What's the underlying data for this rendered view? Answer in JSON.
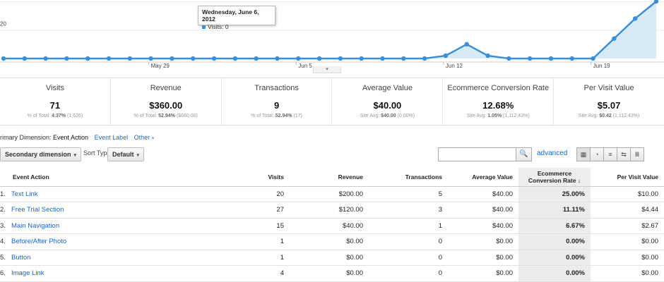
{
  "chart_data": {
    "type": "area",
    "x": [
      "May 22",
      "May 23",
      "May 24",
      "May 25",
      "May 26",
      "May 27",
      "May 28",
      "May 29",
      "May 30",
      "May 31",
      "Jun 1",
      "Jun 2",
      "Jun 3",
      "Jun 4",
      "Jun 5",
      "Jun 6",
      "Jun 7",
      "Jun 8",
      "Jun 9",
      "Jun 10",
      "Jun 11",
      "Jun 12",
      "Jun 13",
      "Jun 14",
      "Jun 15",
      "Jun 16",
      "Jun 17",
      "Jun 18",
      "Jun 19",
      "Jun 20",
      "Jun 21",
      "Jun 22"
    ],
    "series": [
      {
        "values": [
          0,
          0,
          0,
          0,
          0,
          0,
          0,
          0,
          0,
          0,
          0,
          0,
          0,
          0,
          0,
          0,
          0,
          0,
          0,
          0,
          0,
          1,
          5,
          1,
          0,
          0,
          0,
          0,
          0,
          7,
          14,
          20
        ]
      }
    ],
    "y_tick_labels": [
      "20"
    ],
    "x_tick_labels": [
      "May 29",
      "Jun 5",
      "Jun 12",
      "Jun 19"
    ],
    "ylim": [
      0,
      20
    ],
    "color": "#3a8fd6",
    "fill": "#d9eaf7",
    "grid": true
  },
  "tooltip": {
    "date": "Wednesday, June 6, 2012",
    "series": "Visits: 0"
  },
  "summary": [
    {
      "label": "Visits",
      "value": "71",
      "sub_prefix": "% of Total: ",
      "sub_bold": "4.37%",
      "sub_suffix": " (1,626)"
    },
    {
      "label": "Revenue",
      "value": "$360.00",
      "sub_prefix": "% of Total: ",
      "sub_bold": "52.94%",
      "sub_suffix": " ($680.00)"
    },
    {
      "label": "Transactions",
      "value": "9",
      "sub_prefix": "% of Total: ",
      "sub_bold": "52.94%",
      "sub_suffix": " (17)"
    },
    {
      "label": "Average Value",
      "value": "$40.00",
      "sub_prefix": "Site Avg: ",
      "sub_bold": "$40.00",
      "sub_suffix": " (0.00%)"
    },
    {
      "label": "Ecommerce Conversion Rate",
      "value": "12.68%",
      "sub_prefix": "Site Avg: ",
      "sub_bold": "1.05%",
      "sub_suffix": " (1,112.43%)"
    },
    {
      "label": "Per Visit Value",
      "value": "$5.07",
      "sub_prefix": "Site Avg: ",
      "sub_bold": "$0.42",
      "sub_suffix": " (1,112.43%)"
    }
  ],
  "dimensions": {
    "label": "rimary Dimension:",
    "current": "Event Action",
    "option1": "Event Label",
    "option2": "Other",
    "caret": "▾"
  },
  "toolbar": {
    "secondary": "Secondary dimension",
    "sort_label": "Sort Type:",
    "sort_value": "Default",
    "caret": "▾",
    "search_value": "",
    "search_icon": "🔍",
    "advanced": "advanced",
    "view_icons": [
      "▦",
      "◔",
      "≡",
      "⇆",
      "Ⅲ"
    ]
  },
  "table": {
    "headers": [
      "Event Action",
      "Visits",
      "Revenue",
      "Transactions",
      "Average Value",
      "Ecommerce Conversion Rate",
      "Per Visit Value"
    ],
    "sort_arrow": "↓",
    "rows": [
      {
        "idx": "1.",
        "name": "Text Link",
        "visits": "20",
        "revenue": "$200.00",
        "transactions": "5",
        "avg": "$40.00",
        "conv": "25.00%",
        "pvv": "$10.00"
      },
      {
        "idx": "2.",
        "name": "Free Trial Section",
        "visits": "27",
        "revenue": "$120.00",
        "transactions": "3",
        "avg": "$40.00",
        "conv": "11.11%",
        "pvv": "$4.44"
      },
      {
        "idx": "3.",
        "name": "Main Navigation",
        "visits": "15",
        "revenue": "$40.00",
        "transactions": "1",
        "avg": "$40.00",
        "conv": "6.67%",
        "pvv": "$2.67"
      },
      {
        "idx": "4.",
        "name": "Before/After Photo",
        "visits": "1",
        "revenue": "$0.00",
        "transactions": "0",
        "avg": "$0.00",
        "conv": "0.00%",
        "pvv": "$0.00"
      },
      {
        "idx": "5.",
        "name": "Button",
        "visits": "1",
        "revenue": "$0.00",
        "transactions": "0",
        "avg": "$0.00",
        "conv": "0.00%",
        "pvv": "$0.00"
      },
      {
        "idx": "6.",
        "name": "Image Link",
        "visits": "4",
        "revenue": "$0.00",
        "transactions": "0",
        "avg": "$0.00",
        "conv": "0.00%",
        "pvv": "$0.00"
      }
    ]
  }
}
